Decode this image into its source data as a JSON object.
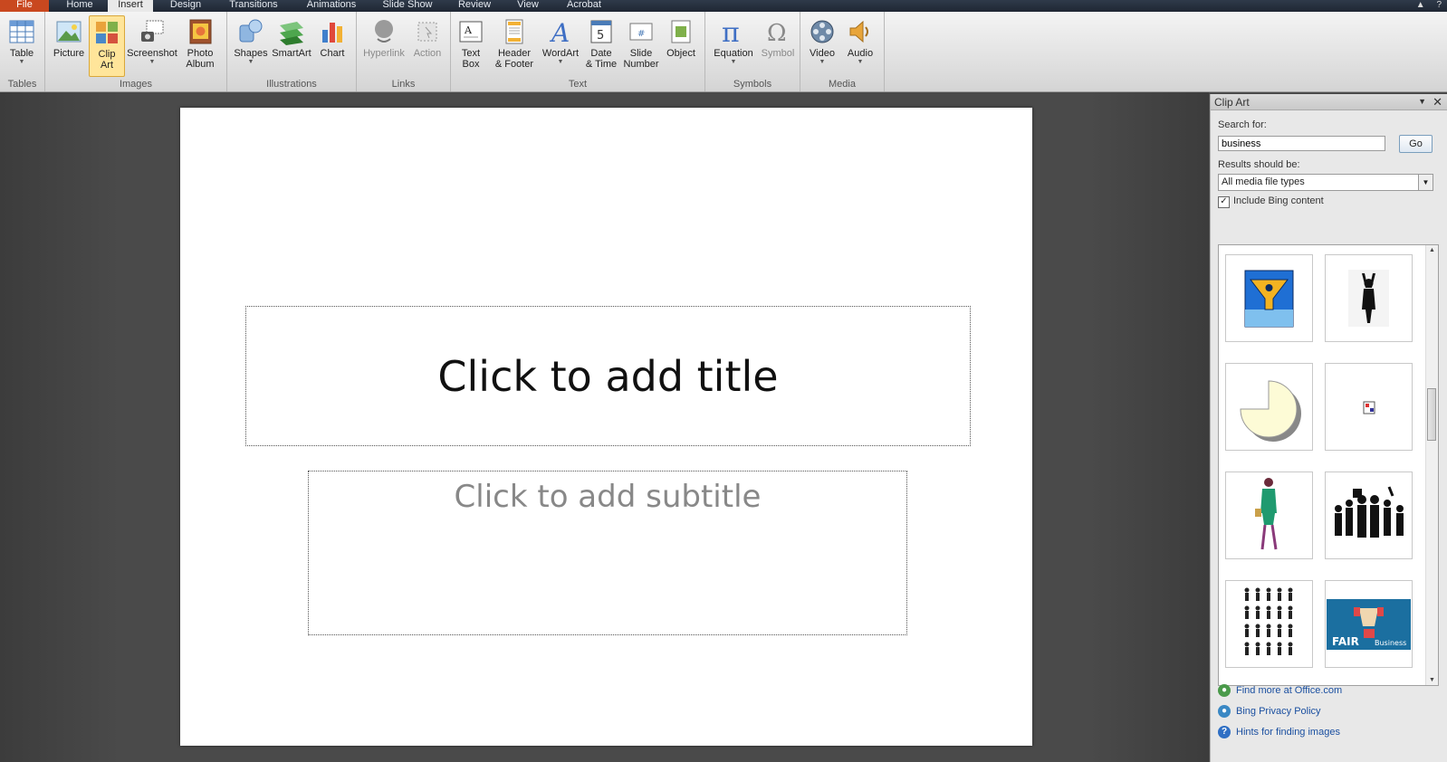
{
  "tabs": [
    {
      "label": "File",
      "kind": "file"
    },
    {
      "label": "Home"
    },
    {
      "label": "Insert",
      "active": true
    },
    {
      "label": "Design"
    },
    {
      "label": "Transitions"
    },
    {
      "label": "Animations"
    },
    {
      "label": "Slide Show"
    },
    {
      "label": "Review"
    },
    {
      "label": "View"
    },
    {
      "label": "Acrobat"
    }
  ],
  "ribbon": {
    "groups": {
      "tables": "Tables",
      "images": "Images",
      "illustrations": "Illustrations",
      "links": "Links",
      "text": "Text",
      "symbols": "Symbols",
      "media": "Media"
    },
    "buttons": {
      "table": "Table",
      "picture": "Picture",
      "clip_art": "Clip\nArt",
      "screenshot": "Screenshot",
      "photo_album": "Photo\nAlbum",
      "shapes": "Shapes",
      "smartart": "SmartArt",
      "chart": "Chart",
      "hyperlink": "Hyperlink",
      "action": "Action",
      "text_box": "Text\nBox",
      "header_footer": "Header\n& Footer",
      "wordart": "WordArt",
      "date_time": "Date\n& Time",
      "slide_number": "Slide\nNumber",
      "object": "Object",
      "equation": "Equation",
      "symbol": "Symbol",
      "video": "Video",
      "audio": "Audio"
    }
  },
  "slide": {
    "title_placeholder": "Click to add title",
    "subtitle_placeholder": "Click to add subtitle"
  },
  "clip_art_pane": {
    "title": "Clip Art",
    "search_label": "Search for:",
    "search_value": "business",
    "go_label": "Go",
    "results_label": "Results should be:",
    "results_value": "All media file types",
    "include_bing_label": "Include Bing content",
    "include_bing_checked": true,
    "results": [
      {
        "icon": "funnel-info-clipart"
      },
      {
        "icon": "raised-arms-silhouette-clipart"
      },
      {
        "icon": "pie-chart-clipart"
      },
      {
        "icon": "placeholder-image-clipart"
      },
      {
        "icon": "businesswoman-clipart"
      },
      {
        "icon": "group-silhouettes-clipart"
      },
      {
        "icon": "many-people-silhouettes-clipart"
      },
      {
        "icon": "fair-business-handshake-clipart",
        "caption_left": "FAIR",
        "caption_right": "Business"
      }
    ],
    "links": [
      {
        "label": "Find more at Office.com",
        "icon": "office-globe-icon"
      },
      {
        "label": "Bing Privacy Policy",
        "icon": "bing-globe-icon"
      },
      {
        "label": "Hints for finding images",
        "icon": "help-icon"
      }
    ]
  },
  "colors": {
    "file_tab": "#c9481f",
    "active_button": "#ffe59a",
    "link": "#1a4fa0"
  }
}
